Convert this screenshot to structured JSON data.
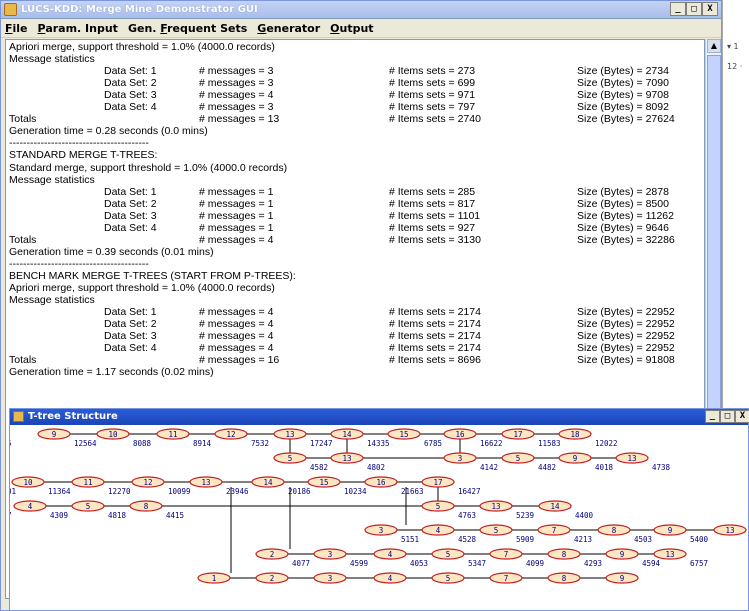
{
  "main_window": {
    "title": "LUCS-KDD: Merge Mine Demonstrator GUI",
    "buttons": {
      "minimize": "_",
      "maximize": "□",
      "close": "X"
    }
  },
  "menu": [
    {
      "label": "File",
      "ul": "F",
      "rest": "ile"
    },
    {
      "label": "Param. Input",
      "ul": "P",
      "rest": "aram. Input"
    },
    {
      "label": "Gen. Frequent Sets",
      "pre": "Gen. ",
      "ul": "F",
      "rest": "requent Sets"
    },
    {
      "label": "Generator",
      "ul": "G",
      "rest": "enerator"
    },
    {
      "label": "Output",
      "ul": "O",
      "rest": "utput"
    }
  ],
  "output_text": {
    "lines": [
      {
        "t": "Apriori merge, support threshold = 1.0% (4000.0 records)"
      },
      {
        "t": "Message statistics"
      },
      {
        "row": [
          "Data Set: 1",
          "# messages = 3",
          "# Items sets = 273",
          "Size (Bytes) = 2734"
        ]
      },
      {
        "row": [
          "Data Set: 2",
          "# messages = 3",
          "# Items sets = 699",
          "Size (Bytes) = 7090"
        ]
      },
      {
        "row": [
          "Data Set: 3",
          "# messages = 4",
          "# Items sets = 971",
          "Size (Bytes) = 9708"
        ]
      },
      {
        "row": [
          "Data Set: 4",
          "# messages = 3",
          "# Items sets = 797",
          "Size (Bytes) = 8092"
        ]
      },
      {
        "total": [
          "Totals",
          "# messages = 13",
          "# Items sets = 2740",
          "Size (Bytes) = 27624"
        ]
      },
      {
        "t": "Generation time = 0.28 seconds (0.0 mins)"
      },
      {
        "t": "----------------------------------------"
      },
      {
        "t": "STANDARD MERGE T-TREES:"
      },
      {
        "t": "Standard merge, support threshold = 1.0% (4000.0 records)"
      },
      {
        "t": "Message statistics"
      },
      {
        "row": [
          "Data Set: 1",
          "# messages = 1",
          "# Items sets = 285",
          "Size (Bytes) = 2878"
        ]
      },
      {
        "row": [
          "Data Set: 2",
          "# messages = 1",
          "# Items sets = 817",
          "Size (Bytes) = 8500"
        ]
      },
      {
        "row": [
          "Data Set: 3",
          "# messages = 1",
          "# Items sets = 1101",
          "Size (Bytes) = 11262"
        ]
      },
      {
        "row": [
          "Data Set: 4",
          "# messages = 1",
          "# Items sets = 927",
          "Size (Bytes) = 9646"
        ]
      },
      {
        "total": [
          "Totals",
          "# messages = 4",
          "# Items sets = 3130",
          "Size (Bytes) = 32286"
        ]
      },
      {
        "t": "Generation time = 0.39 seconds (0.01 mins)"
      },
      {
        "t": "----------------------------------------"
      },
      {
        "t": "BENCH MARK MERGE T-TREES (START FROM P-TREES):"
      },
      {
        "t": "Apriori merge, support threshold = 1.0% (4000.0 records)"
      },
      {
        "t": "Message statistics"
      },
      {
        "row": [
          "Data Set: 1",
          "# messages = 4",
          "# Items sets = 2174",
          "Size (Bytes) = 22952"
        ]
      },
      {
        "row": [
          "Data Set: 2",
          "# messages = 4",
          "# Items sets = 2174",
          "Size (Bytes) = 22952"
        ]
      },
      {
        "row": [
          "Data Set: 3",
          "# messages = 4",
          "# Items sets = 2174",
          "Size (Bytes) = 22952"
        ]
      },
      {
        "row": [
          "Data Set: 4",
          "# messages = 4",
          "# Items sets = 2174",
          "Size (Bytes) = 22952"
        ]
      },
      {
        "total": [
          "Totals",
          "# messages = 16",
          "# Items sets = 8696",
          "Size (Bytes) = 91808"
        ]
      },
      {
        "t": "Generation time = 1.17 seconds (0.02 mins)"
      }
    ]
  },
  "ttree_window": {
    "title": "T-tree Structure",
    "buttons": {
      "minimize": "_",
      "maximize": "□",
      "close": "X"
    },
    "rows": [
      {
        "nodes": [
          {
            "n": "9",
            "v": "12564"
          },
          {
            "n": "10",
            "v": "8088"
          },
          {
            "n": "11",
            "v": "8914"
          },
          {
            "n": "12",
            "v": "7532"
          },
          {
            "n": "13",
            "v": "17247"
          },
          {
            "n": "14",
            "v": "14335"
          },
          {
            "n": "15",
            "v": "6785"
          },
          {
            "n": "16",
            "v": "16622"
          },
          {
            "n": "17",
            "v": "11583"
          },
          {
            "n": "18",
            "v": "12022"
          }
        ],
        "lead": "5"
      },
      {
        "nodes": [
          {
            "n": "5",
            "v": "4582"
          },
          {
            "n": "13",
            "v": "4802"
          },
          {
            "n": "3",
            "v": "4142"
          },
          {
            "n": "5",
            "v": "4482"
          },
          {
            "n": "9",
            "v": "4018"
          },
          {
            "n": "13",
            "v": "4738"
          }
        ]
      },
      {
        "nodes": [
          {
            "n": "10",
            "v": "11364"
          },
          {
            "n": "11",
            "v": "12270"
          },
          {
            "n": "12",
            "v": "10099"
          },
          {
            "n": "13",
            "v": "23946"
          },
          {
            "n": "14",
            "v": "20186"
          },
          {
            "n": "15",
            "v": "10234"
          },
          {
            "n": "16",
            "v": "21663"
          },
          {
            "n": "17",
            "v": "16427"
          }
        ],
        "lead": "01"
      },
      {
        "nodes": [
          {
            "n": "4",
            "v": "4309"
          },
          {
            "n": "5",
            "v": "4818"
          },
          {
            "n": "8",
            "v": "4415"
          },
          {
            "n": "5",
            "v": "4763"
          },
          {
            "n": "13",
            "v": "5239"
          },
          {
            "n": "14",
            "v": "4400"
          }
        ],
        "lead": "7"
      },
      {
        "nodes": [
          {
            "n": "3",
            "v": "5151"
          },
          {
            "n": "4",
            "v": "4528"
          },
          {
            "n": "5",
            "v": "5909"
          },
          {
            "n": "7",
            "v": "4213"
          },
          {
            "n": "8",
            "v": "4503"
          },
          {
            "n": "9",
            "v": "5400"
          },
          {
            "n": "13",
            "v": ""
          }
        ]
      },
      {
        "nodes": [
          {
            "n": "2",
            "v": "4077"
          },
          {
            "n": "3",
            "v": "4599"
          },
          {
            "n": "4",
            "v": "4053"
          },
          {
            "n": "5",
            "v": "5347"
          },
          {
            "n": "7",
            "v": "4099"
          },
          {
            "n": "8",
            "v": "4293"
          },
          {
            "n": "9",
            "v": "4594"
          },
          {
            "n": "13",
            "v": "6757"
          }
        ]
      },
      {
        "nodes": [
          {
            "n": "1",
            "v": ""
          },
          {
            "n": "2",
            "v": ""
          },
          {
            "n": "3",
            "v": ""
          },
          {
            "n": "4",
            "v": ""
          },
          {
            "n": "5",
            "v": ""
          },
          {
            "n": "7",
            "v": ""
          },
          {
            "n": "8",
            "v": ""
          },
          {
            "n": "9",
            "v": ""
          }
        ]
      }
    ]
  },
  "bg_window": {
    "texts": [
      "▾ 1",
      "12 ·"
    ]
  }
}
